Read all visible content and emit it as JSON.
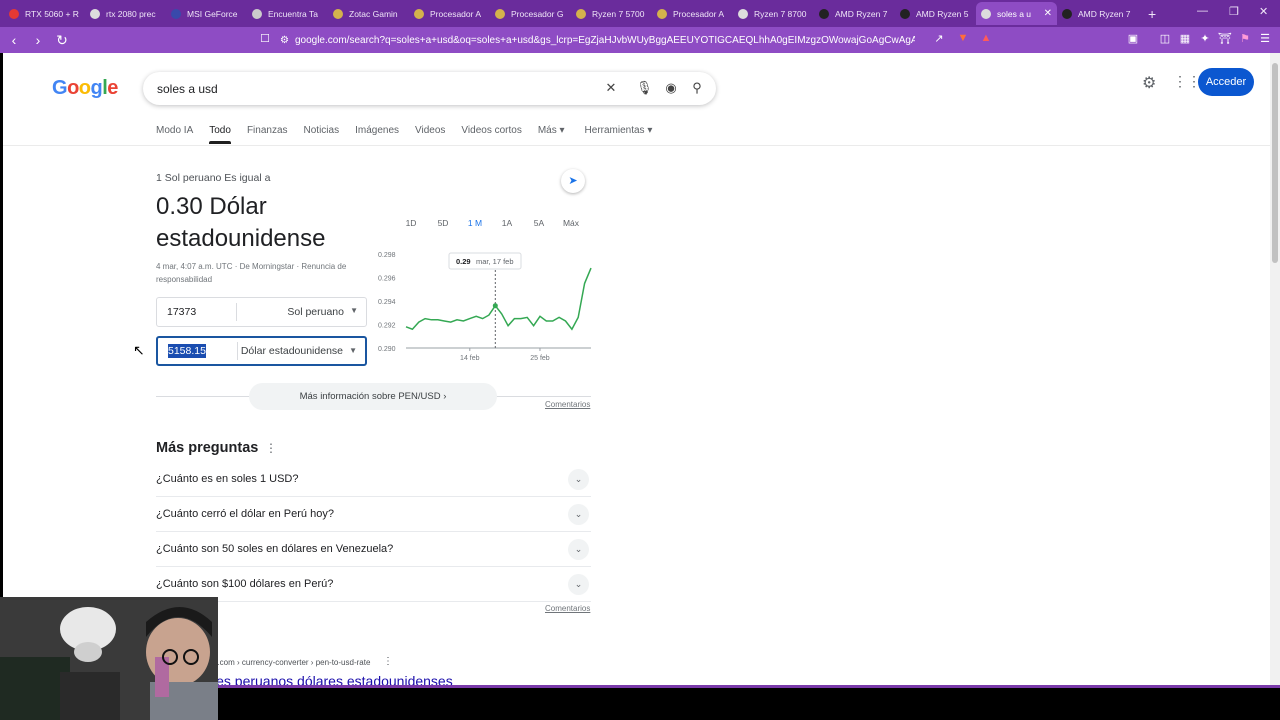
{
  "browser": {
    "tabs": [
      {
        "title": "RTX 5060 + R",
        "color": "#e53935"
      },
      {
        "title": "rtx 2080 prec",
        "color": "#dddddd"
      },
      {
        "title": "MSI GeForce",
        "color": "#3949ab"
      },
      {
        "title": "Encuentra Ta",
        "color": "#cccccc"
      },
      {
        "title": "Zotac Gamin",
        "color": "#d4b24c"
      },
      {
        "title": "Procesador A",
        "color": "#d4b24c"
      },
      {
        "title": "Procesador G",
        "color": "#d4b24c"
      },
      {
        "title": "Ryzen 7 5700",
        "color": "#d4b24c"
      },
      {
        "title": "Procesador A",
        "color": "#d4b24c"
      },
      {
        "title": "Ryzen 7 8700",
        "color": "#dddddd"
      },
      {
        "title": "AMD Ryzen 7",
        "color": "#222222"
      },
      {
        "title": "AMD Ryzen 5",
        "color": "#222222"
      },
      {
        "title": "soles a u",
        "color": "#dddddd"
      },
      {
        "title": "AMD Ryzen 7",
        "color": "#222222"
      }
    ],
    "active_tab_index": 12,
    "url": "google.com/search?q=soles+a+usd&oq=soles+a+usd&gs_lcrp=EgZjaHJvbWUyBggAEEUYOTIGCAEQLhhA0gEIMzgzOWowajGoAgCwAgA&sourceid..."
  },
  "google": {
    "logo": "Google",
    "query": "soles a usd",
    "signin": "Acceder",
    "nav": [
      "Modo IA",
      "Todo",
      "Finanzas",
      "Noticias",
      "Imágenes",
      "Videos",
      "Videos cortos",
      "Más",
      "Herramientas"
    ],
    "nav_active": "Todo"
  },
  "converter": {
    "equals_text": "1 Sol peruano Es igual a",
    "result": "0.30 Dólar estadounidense",
    "meta": "4 mar, 4:07 a.m. UTC · De Morningstar · Renuncia de responsabilidad",
    "from_value": "17373",
    "from_unit": "Sol peruano",
    "to_value": "5158.15",
    "to_unit": "Dólar estadounidense",
    "ranges": [
      "1D",
      "5D",
      "1 M",
      "1A",
      "5A",
      "Máx"
    ],
    "selected_range": "1 M",
    "tooltip_value": "0.29",
    "tooltip_date": "mar, 17 feb",
    "more_info": "Más información sobre PEN/USD",
    "feedback": "Comentarios"
  },
  "chart_data": {
    "type": "line",
    "x_ticks": [
      "14 feb",
      "25 feb"
    ],
    "y_ticks": [
      0.298,
      0.296,
      0.294,
      0.292,
      0.29
    ],
    "ylim": [
      0.29,
      0.298
    ],
    "color": "#34a853",
    "values": [
      0.2918,
      0.2916,
      0.2922,
      0.2925,
      0.2924,
      0.2924,
      0.2923,
      0.2922,
      0.2924,
      0.2923,
      0.2925,
      0.2927,
      0.2925,
      0.2928,
      0.2936,
      0.2929,
      0.2919,
      0.2925,
      0.2925,
      0.2926,
      0.2919,
      0.2927,
      0.2923,
      0.2923,
      0.2926,
      0.2923,
      0.2916,
      0.2926,
      0.2955,
      0.2968
    ]
  },
  "paa": {
    "title": "Más preguntas",
    "questions": [
      "¿Cuánto es en soles 1 USD?",
      "¿Cuánto cerró el dólar en Perú hoy?",
      "¿Cuánto son 50 soles en dólares en Venezuela?",
      "¿Cuánto son $100 dólares en Perú?"
    ],
    "feedback": "Comentarios"
  },
  "next_result": {
    "cite": "e.com › currency-converter › pen-to-usd-rate",
    "title": "les peruanos dólares estadounidenses"
  }
}
